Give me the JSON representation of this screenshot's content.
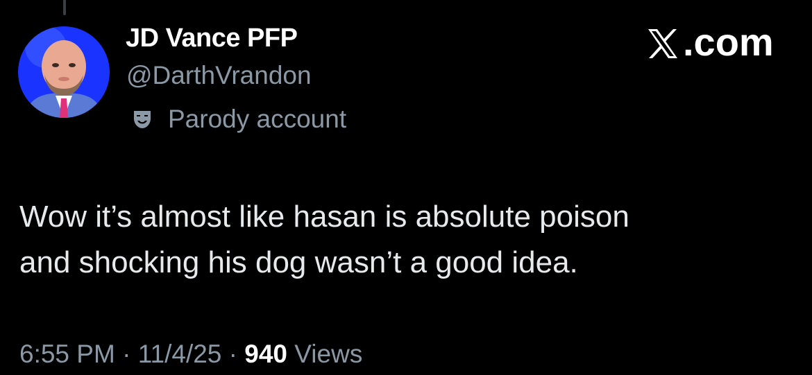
{
  "author": {
    "display_name": "JD Vance PFP",
    "handle": "@DarthVrandon",
    "label": "Parody account",
    "label_icon": "theater-mask-icon"
  },
  "brand": {
    "text": ".com",
    "logo_icon": "x-logo-icon"
  },
  "tweet": {
    "line1": "Wow it’s almost like hasan is absolute poison",
    "line2": "and shocking his dog wasn’t a good idea."
  },
  "meta": {
    "time": "6:55 PM",
    "separator": "·",
    "date": "11/4/25",
    "view_count": "940",
    "views_label": "Views"
  },
  "colors": {
    "background": "#000000",
    "primary_text": "#e7e9ea",
    "secondary_text": "#8b98a5",
    "avatar_bg": "#1a33ff"
  }
}
